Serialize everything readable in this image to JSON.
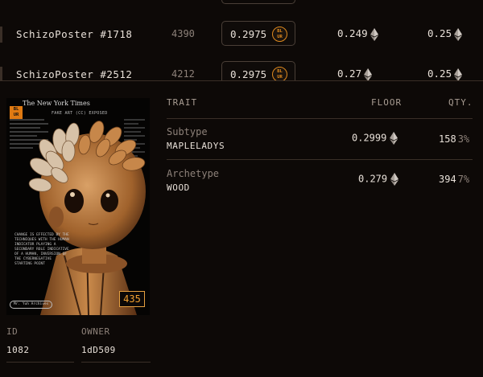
{
  "listings": [
    {
      "name": "SchizoPoster #1718",
      "rank": "4390",
      "price": "0.2975",
      "badge": "BL\nUR",
      "col1": "0.249",
      "col2": "0.25"
    },
    {
      "name": "SchizoPoster #2512",
      "rank": "4212",
      "price": "0.2975",
      "badge": "BL\nUR",
      "col1": "0.27",
      "col2": "0.25"
    }
  ],
  "detail": {
    "poster": {
      "masthead": "The New York Times",
      "headline": "FAKE ART (CC) EXPOSED",
      "logo": "BL\nUR",
      "caption": "CHANGE IS EFFECTED BY THE TECHNIQUES WITH THE HUMAN INDICATOR PLAYING A SECONDARY ROLE INDICATIVE OF A HUMAN, INVERSION OF THE CYBERNEGATIVE STARTING POINT",
      "stamp": "Mr. Yuh Archives",
      "number": "435"
    },
    "id_label": "ID",
    "id_value": "1082",
    "owner_label": "OWNER",
    "owner_value": "1dD509",
    "traits_header": {
      "trait": "TRAIT",
      "floor": "FLOOR",
      "qty": "QTY."
    },
    "traits": [
      {
        "label": "Subtype",
        "value": "MAPLELADYS",
        "floor": "0.2999",
        "qty": "158",
        "pct": "3%"
      },
      {
        "label": "Archetype",
        "value": "WOOD",
        "floor": "0.279",
        "qty": "394",
        "pct": "7%"
      }
    ]
  },
  "colors": {
    "background": "#0d0907",
    "accent": "#e08a1e",
    "text": "#e8e0d8",
    "muted": "#8d8179"
  },
  "icons": [
    "eth-icon",
    "blur-badge-icon"
  ]
}
